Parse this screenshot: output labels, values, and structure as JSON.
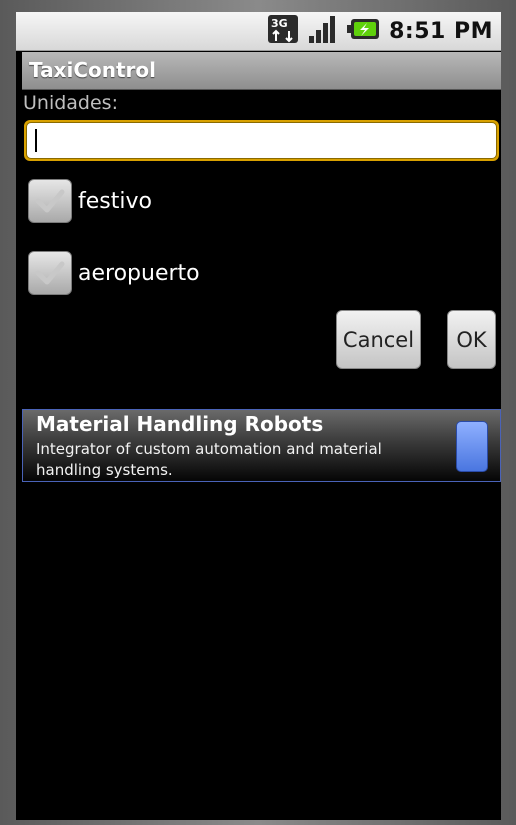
{
  "status_bar": {
    "time": "8:51 PM",
    "network_label": "3G",
    "icons": [
      "network-3g-icon",
      "signal-strength-icon",
      "battery-charging-icon"
    ]
  },
  "app": {
    "title": "TaxiControl"
  },
  "form": {
    "units_label": "Unidades:",
    "units_value": "",
    "checkboxes": [
      {
        "label": "festivo",
        "checked": false
      },
      {
        "label": "aeropuerto",
        "checked": false
      }
    ],
    "cancel_label": "Cancel",
    "ok_label": "OK"
  },
  "ad": {
    "title": "Material Handling Robots",
    "description": "Integrator of custom automation and material handling systems."
  },
  "colors": {
    "input_focus": "#d9a100",
    "ad_border": "#4a63b8",
    "ad_action": "#4a76e0"
  }
}
